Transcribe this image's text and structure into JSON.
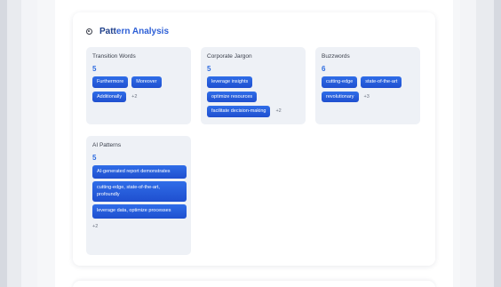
{
  "section": {
    "title_part1": "Patt",
    "title_part2": "ern Analysis"
  },
  "tiles": [
    {
      "name": "Transition Words",
      "count": "5",
      "chips": [
        "Furthermore",
        "Moreover",
        "Additionally"
      ],
      "more": "+2"
    },
    {
      "name": "Corporate Jargon",
      "count": "5",
      "chips": [
        "leverage insights",
        "optimize resources",
        "facilitate decision-making"
      ],
      "more": "+2"
    },
    {
      "name": "Buzzwords",
      "count": "6",
      "chips": [
        "cutting-edge",
        "state-of-the-art",
        "revolutionary"
      ],
      "more": "+3"
    },
    {
      "name": "AI Patterns",
      "count": "5",
      "chips": [
        "AI-generated report demonstrates",
        "cutting-edge, state-of-the-art, profoundly",
        "leverage data, optimize processes"
      ],
      "more": "+2"
    }
  ],
  "colors": {
    "accent": "#2c6be0",
    "chip": "#2258d8",
    "title": "#1e3f8a"
  },
  "icons": {
    "header": "target-icon"
  }
}
